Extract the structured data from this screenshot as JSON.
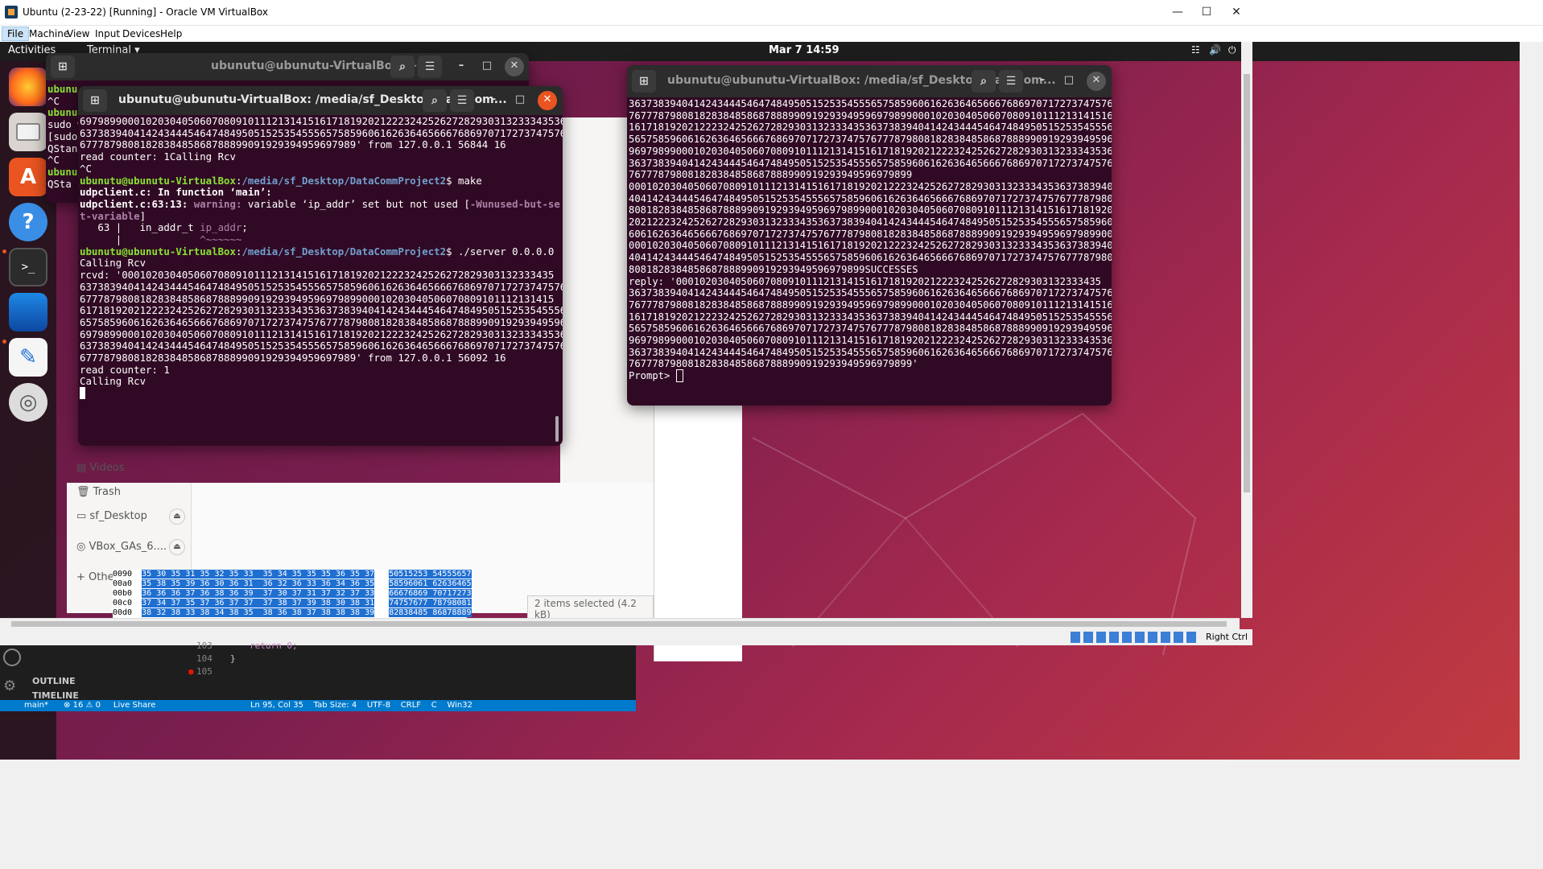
{
  "host": {
    "title": "Ubuntu (2-23-22) [Running] - Oracle VM VirtualBox",
    "menu": [
      "File",
      "Machine",
      "View",
      "Input",
      "Devices",
      "Help"
    ],
    "status_right": "Right Ctrl"
  },
  "gnome": {
    "activities": "Activities",
    "app_menu": "Terminal ▾",
    "clock": "Mar 7  14:59"
  },
  "term_back": {
    "title": "ubunutu@ubunutu-VirtualBox: ~",
    "lines": [
      "ubunu",
      "^C",
      "ubunu",
      "sudo w",
      "[sudo",
      "QStan",
      "^C",
      "ubunu",
      "QSta"
    ]
  },
  "term_main": {
    "title": "ubunutu@ubunutu-VirtualBox: /media/sf_Desktop/DataCom...",
    "line01": "697989900010203040506070809101112131415161718192021222324252627282930313233343536",
    "line02": "637383940414243444546474849505152535455565758596061626364656667686970717273747576",
    "line03": "6777879808182838485868788899091929394959697989' from 127.0.0.1 56844 16",
    "line04": "read counter: 1Calling Rcv",
    "line05": "^C",
    "prompt_user": "ubunutu@ubunutu-VirtualBox",
    "prompt_path": "/media/sf_Desktop/DataCommProject2",
    "cmd_make": "$ make",
    "line07": "udpclient.c: In function ‘main’:",
    "warn_loc": "udpclient.c:63:13:",
    "warn_label": "warning:",
    "warn_text": " variable ‘ip_addr’ set but not used [",
    "warn_flag": "-Wunused-but-se",
    "warn_flag2": "t-variable",
    "warn_flag_end": "]",
    "code_line": "   63 |   in_addr_t ",
    "code_var": "ip_addr",
    "code_semicolon": ";",
    "caret_line": "      |             ",
    "caret": "^~~~~~~",
    "cmd_server": "$ ./server 0.0.0.0",
    "calling1": "Calling Rcv",
    "rcvd1": "rcvd: '000102030405060708091011121314151617181920212223242526272829303132333435",
    "rcvd2": "637383940414243444546474849505152535455565758596061626364656667686970717273747576",
    "rcvd3": "6777879808182838485868788899091929394959697989900010203040506070809101112131415",
    "rcvd4": "617181920212223242526272829303132333435363738394041424344454647484950515253545556",
    "rcvd5": "657585960616263646566676869707172737475767778798081828384858687888990919293949596",
    "rcvd6": "697989900010203040506070809101112131415161718192021222324252627282930313233343536",
    "rcvd7": "637383940414243444546474849505152535455565758596061626364656667686970717273747576",
    "rcvd8": "6777879808182838485868788899091929394959697989' from 127.0.0.1 56092 16",
    "read2": "read counter: 1",
    "calling2": "Calling Rcv"
  },
  "term_right": {
    "title": "ubunutu@ubunutu-VirtualBox: /media/sf_Desktop/DataCom...",
    "lines": [
      "3637383940414243444546474849505152535455565758596061626364656667686970717273747576",
      "7677787980818283848586878889909192939495969798990001020304050607080910111213141516",
      "1617181920212223242526272829303132333435363738394041424344454647484950515253545556",
      "5657585960616263646566676869707172737475767778798081828384858687888990919293949596",
      "9697989900010203040506070809101112131415161718192021222324252627282930313233343536",
      "3637383940414243444546474849505152535455565758596061626364656667686970717273747576",
      "767778798081828384858687888990919293949596979899",
      "0001020304050607080910111213141516171819202122232425262728293031323334353637383940",
      "4041424344454647484950515253545556575859606162636465666768697071727374757677787980",
      "8081828384858687888990919293949596979899000102030405060708091011121314151617181920",
      "2021222324252627282930313233343536373839404142434445464748495051525354555657585960",
      "6061626364656667686970717273747576777879808182838485868788899091929394959697989900",
      "0001020304050607080910111213141516171819202122232425262728293031323334353637383940",
      "4041424344454647484950515253545556575859606162636465666768697071727374757677787980",
      "8081828384858687888990919293949596979899SUCCESSES",
      "reply: '000102030405060708091011121314151617181920212223242526272829303132333435",
      "3637383940414243444546474849505152535455565758596061626364656667686970717273747576",
      "7677787980818283848586878889909192939495969798990001020304050607080910111213141516",
      "1617181920212223242526272829303132333435363738394041424344454647484950515253545556",
      "5657585960616263646566676869707172737475767778798081828384858687888990919293949596",
      "9697989900010203040506070809101112131415161718192021222324252627282930313233343536",
      "3637383940414243444546474849505152535455565758596061626364656667686970717273747576",
      "767778798081828384858687888990919293949596979899'"
    ],
    "prompt": "Prompt> "
  },
  "files": {
    "videos": "Videos",
    "trash": "Trash",
    "sf_desktop": "sf_Desktop",
    "vbox": "VBox_GAs_6....",
    "other": "Other Locations",
    "status": "2 items selected  (4.2 kB)"
  },
  "hex": {
    "rows": [
      {
        "off": "0090",
        "bytes": "35 30 35 31 35 32 35 33  35 34 35 35 35 36 35 37",
        "ascii": "50515253 54555657"
      },
      {
        "off": "00a0",
        "bytes": "35 38 35 39 36 30 36 31  36 32 36 33 36 34 36 35",
        "ascii": "58596061 62636465"
      },
      {
        "off": "00b0",
        "bytes": "36 36 36 37 36 38 36 39  37 30 37 31 37 32 37 33",
        "ascii": "66676869 70717273"
      },
      {
        "off": "00c0",
        "bytes": "37 34 37 35 37 36 37 37  37 38 37 39 38 30 38 31",
        "ascii": "74757677 78798081"
      },
      {
        "off": "00d0",
        "bytes": "38 32 38 33 38 34 38 35  38 36 38 37 38 38 38 39",
        "ascii": "82838485 86878889"
      }
    ]
  },
  "vscode": {
    "outline": "OUTLINE",
    "timeline": "TIMELINE",
    "ln103": "103",
    "code103": "return 0;",
    "ln104": "104",
    "code104": "}",
    "ln105": "105",
    "status": "main*      ⊗ 16 ⚠ 0     Live Share                                     Ln 95, Col 35    Tab Size: 4    UTF-8    CRLF    C    Win32"
  }
}
